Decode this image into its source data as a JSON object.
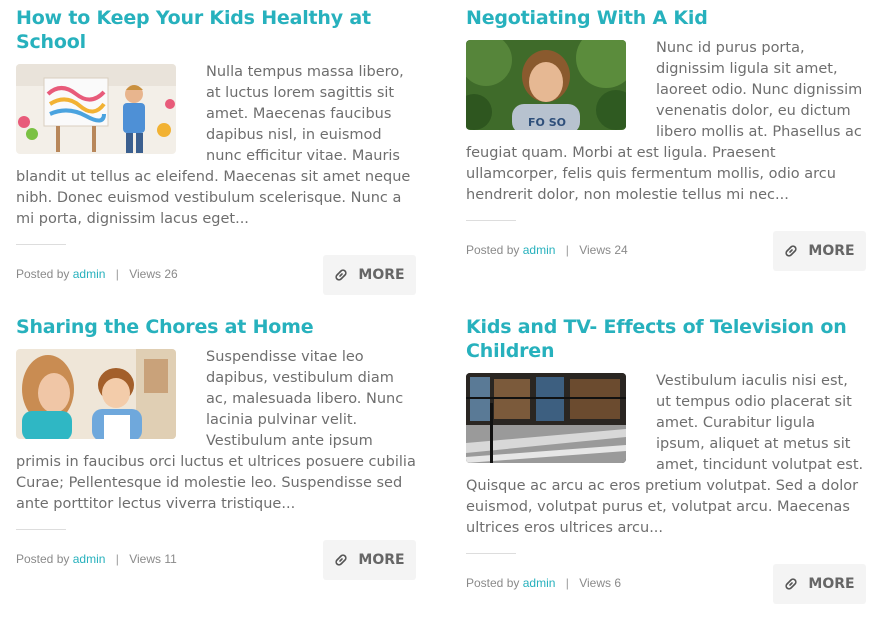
{
  "posts": [
    {
      "title": "How to Keep Your Kids Healthy at School",
      "excerpt": "Nulla tempus massa libero, at luctus lorem sagittis sit amet. Maecenas faucibus dapibus nisl, in euismod nunc efficitur vitae. Mauris blandit ut tellus ac eleifend. Maecenas sit amet neque nibh. Donec euismod vestibulum scelerisque. Nunc a mi porta, dignissim lacus eget...",
      "posted_by_label": "Posted by",
      "author": "admin",
      "separator": "|",
      "views_text": "Views 26",
      "more_label": "MORE",
      "image_icon": "kids-painting-photo"
    },
    {
      "title": "Negotiating With A Kid",
      "excerpt": "Nunc id purus porta, dignissim ligula sit amet, laoreet odio. Nunc dignissim venenatis dolor, eu dictum libero mollis at. Phasellus ac feugiat quam. Morbi at est ligula. Praesent ullamcorper, felis quis fermentum mollis, odio arcu hendrerit dolor, non molestie tellus mi nec...",
      "posted_by_label": "Posted by",
      "author": "admin",
      "separator": "|",
      "views_text": "Views 24",
      "more_label": "MORE",
      "image_icon": "boy-portrait-photo"
    },
    {
      "title": "Sharing the Chores at Home",
      "excerpt": "Suspendisse vitae leo dapibus, vestibulum diam ac, malesuada libero. Nunc lacinia pulvinar velit. Vestibulum ante ipsum primis in faucibus orci luctus et ultrices posuere cubilia Curae; Pellentesque id molestie leo. Suspendisse sed ante porttitor lectus viverra tristique...",
      "posted_by_label": "Posted by",
      "author": "admin",
      "separator": "|",
      "views_text": "Views 11",
      "more_label": "MORE",
      "image_icon": "kids-classroom-photo"
    },
    {
      "title": "Kids and TV- Effects of Television on Children",
      "excerpt": "Vestibulum iaculis nisi est, ut tempus odio placerat sit amet. Curabitur ligula ipsum, aliquet at metus sit amet, tincidunt volutpat est. Quisque ac arcu ac eros pretium volutpat. Sed a dolor euismod, volutpat purus et, volutpat arcu. Maecenas ultrices eros ultrices arcu...",
      "posted_by_label": "Posted by",
      "author": "admin",
      "separator": "|",
      "views_text": "Views 6",
      "more_label": "MORE",
      "image_icon": "library-shelves-photo"
    }
  ],
  "colors": {
    "accent": "#27b1bd",
    "text": "#6e6e6e",
    "button_bg": "#f4f4f4"
  }
}
